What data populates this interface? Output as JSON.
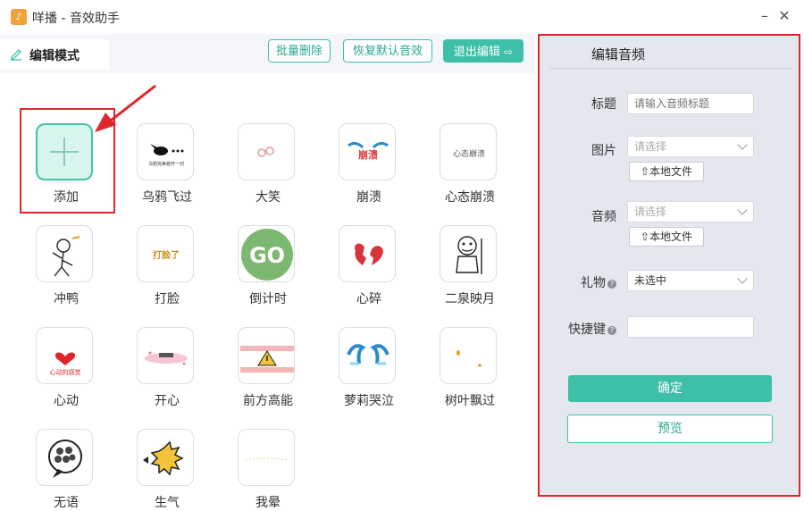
{
  "window": {
    "title": "咩播 - 音效助手",
    "logo_text": "♪"
  },
  "left": {
    "mode_label": "编辑模式",
    "toolbar": {
      "batch_delete": "批量删除",
      "restore_default": "恢复默认音效",
      "exit_edit": "退出编辑"
    },
    "tiles": [
      {
        "label": "添加"
      },
      {
        "label": "乌鸦飞过"
      },
      {
        "label": "大笑"
      },
      {
        "label": "崩溃"
      },
      {
        "label": "心态崩溃"
      },
      {
        "label": "冲鸭"
      },
      {
        "label": "打脸"
      },
      {
        "label": "倒计时"
      },
      {
        "label": "心碎"
      },
      {
        "label": "二泉映月"
      },
      {
        "label": "心动"
      },
      {
        "label": "开心"
      },
      {
        "label": "前方高能"
      },
      {
        "label": "萝莉哭泣"
      },
      {
        "label": "树叶飘过"
      },
      {
        "label": "无语"
      },
      {
        "label": "生气"
      },
      {
        "label": "我晕"
      }
    ],
    "thumb_text": {
      "crow": "乌鸦完美避开一切",
      "collapse": "崩溃",
      "mind": "心态崩溃",
      "slap": "打脸了",
      "go": "GO",
      "heart": "心动的感觉"
    }
  },
  "right": {
    "title": "编辑音频",
    "title_label": "标题",
    "title_placeholder": "请输入音频标题",
    "image_label": "图片",
    "image_placeholder": "请选择",
    "local_file": "本地文件",
    "audio_label": "音频",
    "audio_placeholder": "请选择",
    "gift_label": "礼物",
    "gift_value": "未选中",
    "hotkey_label": "快捷键",
    "confirm": "确定",
    "preview": "预览"
  },
  "colors": {
    "accent": "#3ebfa8",
    "highlight": "#e0262a",
    "panel": "#e4e8ee"
  }
}
